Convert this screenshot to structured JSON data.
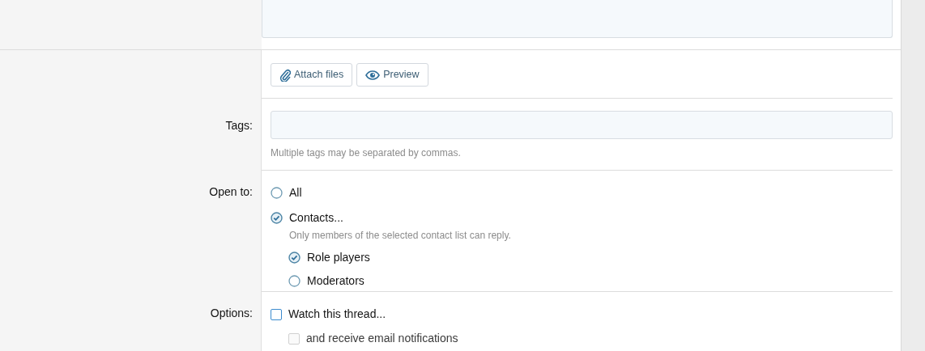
{
  "buttons": [
    {
      "kind": "attach",
      "label": "Attach files"
    },
    {
      "kind": "preview",
      "label": "Preview"
    }
  ],
  "tags": {
    "label": "Tags:",
    "hint": "Multiple tags may be separated by commas."
  },
  "open_to": {
    "label": "Open to:",
    "options": [
      {
        "label": "All",
        "selected": false
      },
      {
        "label": "Contacts...",
        "selected": true,
        "hint": "Only members of the selected contact list can reply.",
        "children": [
          {
            "label": "Role players",
            "selected": true
          },
          {
            "label": "Moderators",
            "selected": false
          }
        ]
      }
    ]
  },
  "options": {
    "label": "Options:",
    "items": [
      {
        "label": "Watch this thread...",
        "checked": false,
        "disabled": false,
        "children": [
          {
            "label": "and receive email notifications",
            "checked": false,
            "disabled": true
          }
        ]
      }
    ]
  }
}
